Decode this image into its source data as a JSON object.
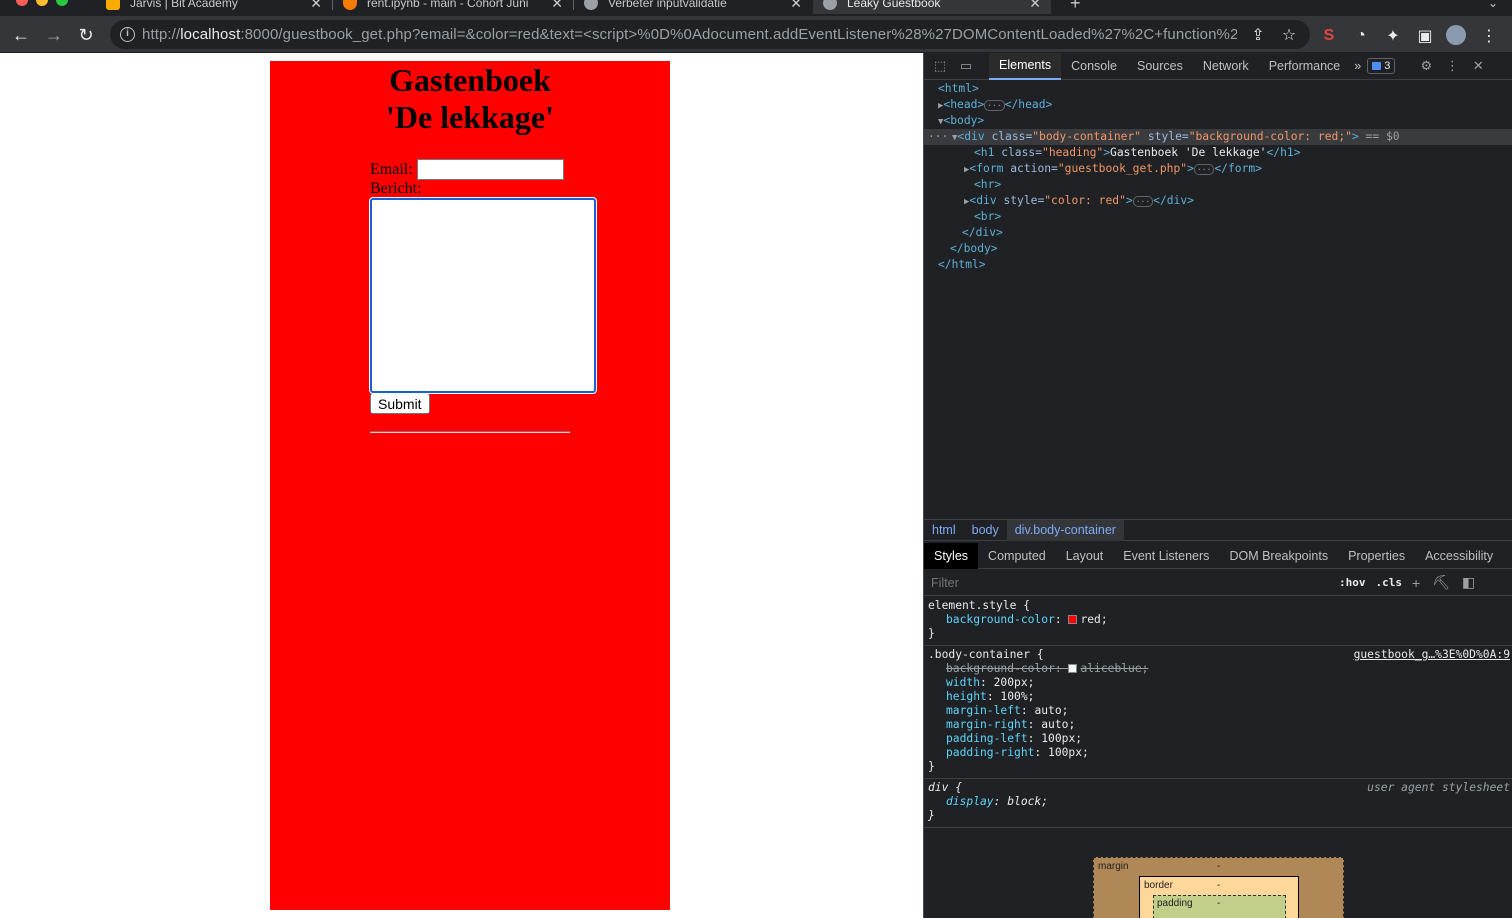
{
  "browser": {
    "tabs": [
      {
        "title": "Jarvis | Bit Academy",
        "favicon_color": "#f9ab00",
        "active": false
      },
      {
        "title": "rent.ipynb - main - Cohort Juni",
        "favicon_color": "#f57c00",
        "active": false
      },
      {
        "title": "Verbeter inputvalidatie",
        "favicon_color": "#9aa0a6",
        "active": false
      },
      {
        "title": "Leaky Guestbook",
        "favicon_color": "#9aa0a6",
        "active": true
      }
    ],
    "new_tab_label": "+",
    "url_prefix": "http://",
    "url_host": "localhost",
    "url_rest": ":8000/guestbook_get.php?email=&color=red&text=<script>%0D%0Adocument.addEventListener%28%27DOMContentLoaded%27%2C+function%2..."
  },
  "page": {
    "heading": "Gastenboek 'De lekkage'",
    "email_label": "Email:",
    "email_value": "",
    "bericht_label": "Bericht:",
    "message_value": "",
    "submit_label": "Submit",
    "container_color": "#ff0000"
  },
  "devtools": {
    "tabs": [
      "Elements",
      "Console",
      "Sources",
      "Network",
      "Performance"
    ],
    "active_tab": "Elements",
    "more_tabs": "»",
    "issues_count": "3",
    "dom": {
      "html_open": "<html>",
      "head": "<head>",
      "head_close": "</head>",
      "body_open": "<body>",
      "div_open_tag": "<div",
      "div_class_attr": " class=",
      "div_class_val": "\"body-container\"",
      "div_style_attr": " style=",
      "div_style_val": "\"background-color: red;\"",
      "div_close_bracket": ">",
      "selected_marker": " == $0",
      "h1_open": "<h1",
      "h1_class_attr": " class=",
      "h1_class_val": "\"heading\"",
      "h1_text": "Gastenboek 'De lekkage'",
      "h1_close": "</h1>",
      "form_open": "<form",
      "form_action_attr": " action=",
      "form_action_val": "\"guestbook_get.php\"",
      "form_close": "</form>",
      "hr": "<hr>",
      "div2_open": "<div",
      "div2_style_attr": " style=",
      "div2_style_val": "\"color: red\"",
      "div2_close": "</div>",
      "br": "<br>",
      "div_close": "</div>",
      "body_close": "</body>",
      "html_close": "</html>",
      "gt": ">",
      "ellipsis": "···"
    },
    "breadcrumbs": [
      "html",
      "body",
      "div.body-container"
    ],
    "style_tabs": [
      "Styles",
      "Computed",
      "Layout",
      "Event Listeners",
      "DOM Breakpoints",
      "Properties",
      "Accessibility"
    ],
    "filter_placeholder": "Filter",
    "hov_label": ":hov",
    "cls_label": ".cls",
    "rules": {
      "element_style": {
        "selector": "element.style {",
        "props": [
          {
            "name": "background-color",
            "value": "red;",
            "swatch": "#ff0000"
          }
        ]
      },
      "body_container": {
        "selector": ".body-container {",
        "source": "guestbook_g…%3E%0D%0A:9",
        "props": [
          {
            "name": "background-color",
            "value": "aliceblue;",
            "swatch": "#f0f8ff",
            "overridden": true
          },
          {
            "name": "width",
            "value": "200px;"
          },
          {
            "name": "height",
            "value": "100%;"
          },
          {
            "name": "margin-left",
            "value": "auto;"
          },
          {
            "name": "margin-right",
            "value": "auto;"
          },
          {
            "name": "padding-left",
            "value": "100px;"
          },
          {
            "name": "padding-right",
            "value": "100px;"
          }
        ]
      },
      "div_rule": {
        "selector": "div {",
        "source": "user agent stylesheet",
        "props": [
          {
            "name": "display",
            "value": "block;"
          }
        ]
      },
      "close_brace": "}",
      "colon": ": "
    },
    "box_model": {
      "margin_label": "margin",
      "border_label": "border",
      "padding_label": "padding",
      "dash": "-"
    }
  }
}
